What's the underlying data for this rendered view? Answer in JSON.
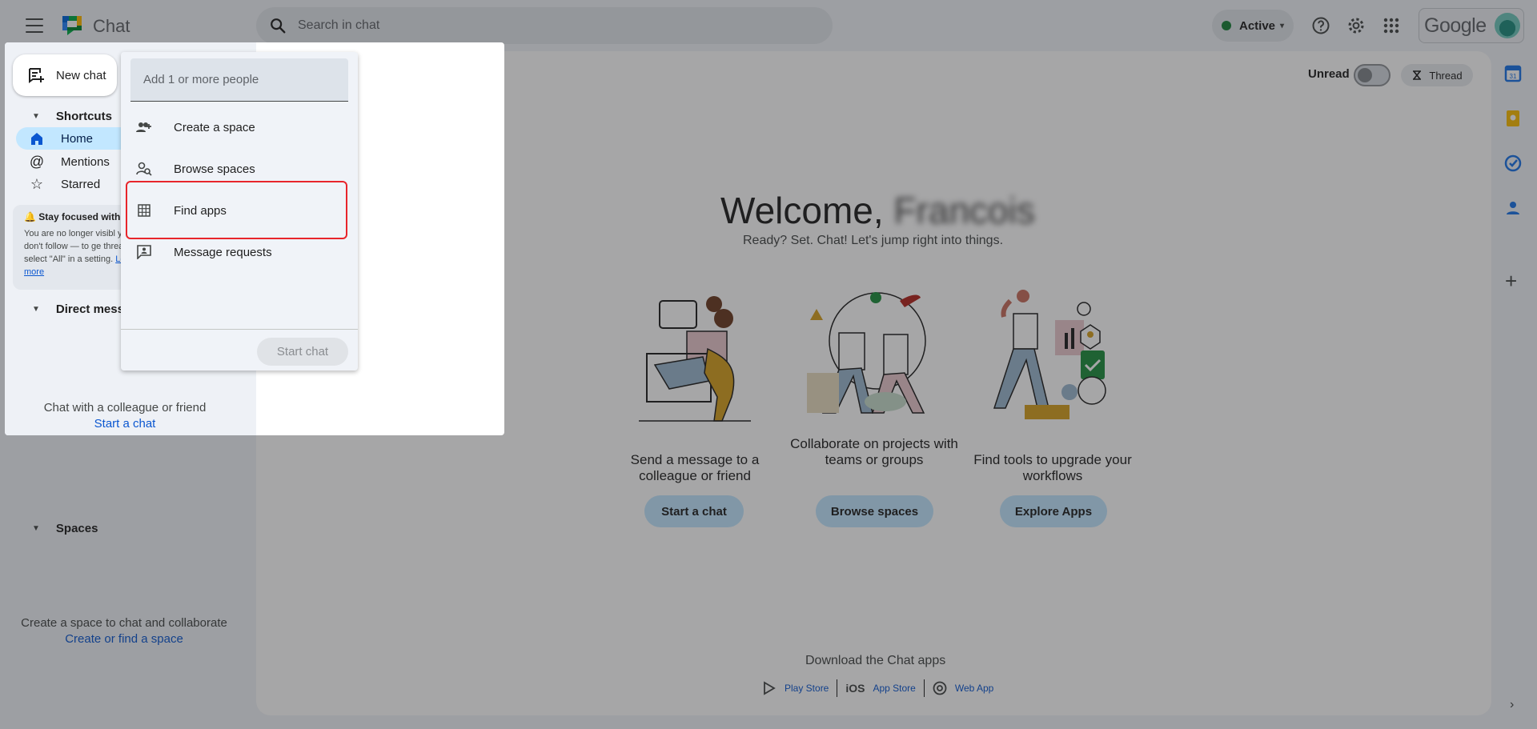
{
  "header": {
    "app_title": "Chat",
    "search_placeholder": "Search in chat",
    "status_label": "Active",
    "google_label": "Google"
  },
  "nav": {
    "spaces_label": "Spaces",
    "spaces_empty_text": "Create a space to chat and collaborate",
    "spaces_empty_link": "Create or find a space"
  },
  "popup_nav": {
    "new_chat_label": "New chat",
    "shortcuts_label": "Shortcuts",
    "home_label": "Home",
    "mentions_label": "Mentions",
    "starred_label": "Starred",
    "focus_title": "Stay focused with",
    "focus_body": "You are no longer visibl you don't follow — to ge threads, select \"All\" in a setting.",
    "focus_link": "Learn more",
    "direct_messages_label": "Direct mess",
    "dm_empty_text": "Chat with a colleague or friend",
    "dm_empty_link": "Start a chat"
  },
  "menu": {
    "input_placeholder": "Add 1 or more people",
    "items": [
      {
        "label": "Create a space",
        "icon": "group-add-icon"
      },
      {
        "label": "Browse spaces",
        "icon": "person-search-icon"
      },
      {
        "label": "Find apps",
        "icon": "apps-grid-icon"
      },
      {
        "label": "Message requests",
        "icon": "message-request-icon"
      }
    ],
    "start_chat_label": "Start chat"
  },
  "main": {
    "unread_label": "Unread",
    "thread_label": "Thread",
    "welcome_prefix": "Welcome,",
    "welcome_name": "Francois",
    "welcome_sub": "Ready? Set. Chat! Let's jump right into things.",
    "cards": [
      {
        "text": "Send a message to a colleague or friend",
        "button": "Start a chat"
      },
      {
        "text": "Collaborate on projects with teams or groups",
        "button": "Browse spaces"
      },
      {
        "text": "Find tools to upgrade your workflows",
        "button": "Explore Apps"
      }
    ],
    "download_title": "Download the Chat apps",
    "play_store": "Play Store",
    "ios_label": "iOS",
    "app_store": "App Store",
    "web_app": "Web App"
  },
  "colors": {
    "accent": "#0b57d0",
    "highlight_outline": "#e8252b",
    "status_green": "#188038",
    "home_selected": "#c2e7ff"
  }
}
